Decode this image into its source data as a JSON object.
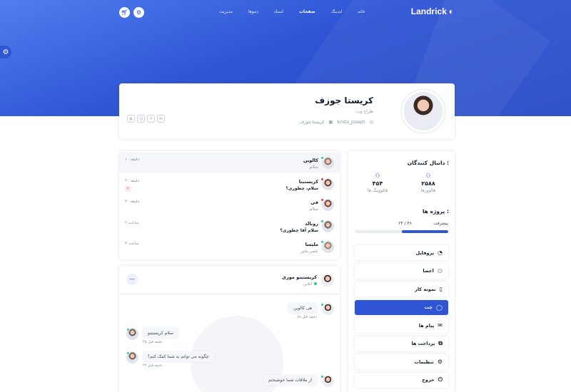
{
  "header": {
    "logo_text": "Landrick",
    "menu": [
      "خانه",
      "لندینگ",
      "صفحات",
      "اسناد",
      "دموها",
      "مدیریت"
    ],
    "active_menu": "صفحات"
  },
  "profile": {
    "name": "کریستا جوزف",
    "role": "طراح وب",
    "username": "krista_joseph",
    "display_name": "کریستا جوزف"
  },
  "sidebar": {
    "followers_title": "دانبال کنندگان :",
    "followers": {
      "value": "۲۵۸۸",
      "label": "فالوورها"
    },
    "following": {
      "value": "۴۵۴",
      "label": "فالووینگ ها"
    },
    "projects_title": "پروژه ها :",
    "progress_label": "پیشرفت",
    "progress_text": "۲۴ / ۴۸",
    "progress_fraction": 0.5,
    "items": [
      {
        "label": "پروفایل",
        "icon": "dashboard-icon",
        "glyph": "◔",
        "active": false
      },
      {
        "label": "اعضا",
        "icon": "users-icon",
        "glyph": "⚇",
        "active": false
      },
      {
        "label": "نمونه کار",
        "icon": "file-icon",
        "glyph": "▯",
        "active": false
      },
      {
        "label": "چت",
        "icon": "chat-icon",
        "glyph": "◯",
        "active": true
      },
      {
        "label": "پیام ها",
        "icon": "inbox-icon",
        "glyph": "✉",
        "active": false
      },
      {
        "label": "پرداخت ها",
        "icon": "transactions-icon",
        "glyph": "⧉",
        "active": false
      },
      {
        "label": "تنظیمات",
        "icon": "settings-icon",
        "glyph": "⚙",
        "active": false
      },
      {
        "label": "خروج",
        "icon": "logout-icon",
        "glyph": "⏻",
        "active": false
      }
    ]
  },
  "conversations": [
    {
      "name": "کالوین",
      "message": "سلام",
      "time": "۱۰ دقیقه",
      "status": "#2eca8b",
      "selected": true,
      "badge": "",
      "bold": false,
      "avatar": "#8a6f5e"
    },
    {
      "name": "کریستینا",
      "message": "سلام، چطوری؟",
      "time": "۲۰ دقیقه",
      "status": "#e43f52",
      "selected": false,
      "badge": "۲",
      "bold": true,
      "avatar": "#5c3b2e"
    },
    {
      "name": "فی",
      "message": "سلام",
      "time": "۳۰ دقیقه",
      "status": "#e43f52",
      "selected": false,
      "badge": "",
      "bold": false,
      "avatar": "#7a3f3a"
    },
    {
      "name": "رونالد",
      "message": "سلام آقا چطوری؟",
      "time": "۲ ساعت",
      "status": "#2eca8b",
      "selected": false,
      "badge": "",
      "bold": true,
      "avatar": "#6b5e54"
    },
    {
      "name": "ملیسا",
      "message": "عصر بخیر",
      "time": "۳ ساعت",
      "status": "#2eca8b",
      "selected": false,
      "badge": "",
      "bold": false,
      "avatar": "#9a7b68"
    }
  ],
  "chat": {
    "name": "کریستینو موری",
    "status": "آنلاین",
    "messages": [
      {
        "side": "right",
        "text": "هی کالوین",
        "time": "۵۹ دقیقه قبل"
      },
      {
        "side": "left",
        "text": "سلام کریستینو",
        "time": "۴۵ دقیقه قبل"
      },
      {
        "side": "left",
        "text": "چگونه می توانم به شما کمک کنم؟",
        "time": "۴۴ دقیقه قبل"
      },
      {
        "side": "right",
        "text": "از ملاقات شما خوشبختم",
        "time": ""
      }
    ]
  }
}
